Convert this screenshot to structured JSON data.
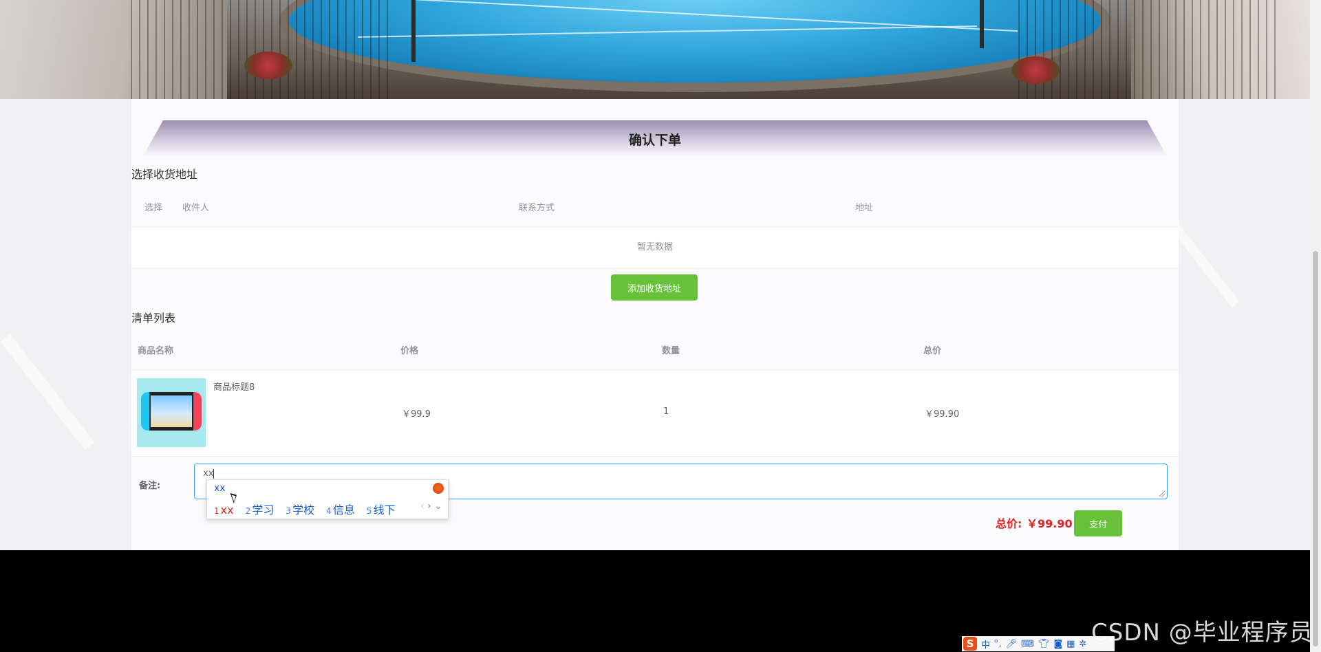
{
  "page": {
    "title": "确认下单"
  },
  "address_section": {
    "label": "选择收货地址",
    "columns": [
      "选择",
      "收件人",
      "联系方式",
      "地址"
    ],
    "empty_text": "暂无数据",
    "add_button": "添加收货地址"
  },
  "order_section": {
    "label": "清单列表",
    "columns": [
      "商品名称",
      "价格",
      "数量",
      "总价"
    ],
    "items": [
      {
        "name": "商品标题8",
        "price": "￥99.9",
        "quantity": "1",
        "subtotal": "￥99.90"
      }
    ]
  },
  "remark": {
    "label": "备注:",
    "value": "xx"
  },
  "summary": {
    "total_label": "总价:",
    "total_value": "￥99.90",
    "pay_button": "支付"
  },
  "ime": {
    "composition": "xx",
    "candidates": [
      {
        "n": "1",
        "text": "xx"
      },
      {
        "n": "2",
        "text": "学习"
      },
      {
        "n": "3",
        "text": "学校"
      },
      {
        "n": "4",
        "text": "信息"
      },
      {
        "n": "5",
        "text": "线下"
      }
    ],
    "toolbar": {
      "logo": "S",
      "mode": "中",
      "punct": "°,",
      "icons": [
        "microphone-icon",
        "keyboard-icon",
        "skin-icon",
        "toolbox-icon",
        "grid-icon",
        "settings-icon"
      ]
    }
  },
  "watermark": "CSDN @毕业程序员"
}
